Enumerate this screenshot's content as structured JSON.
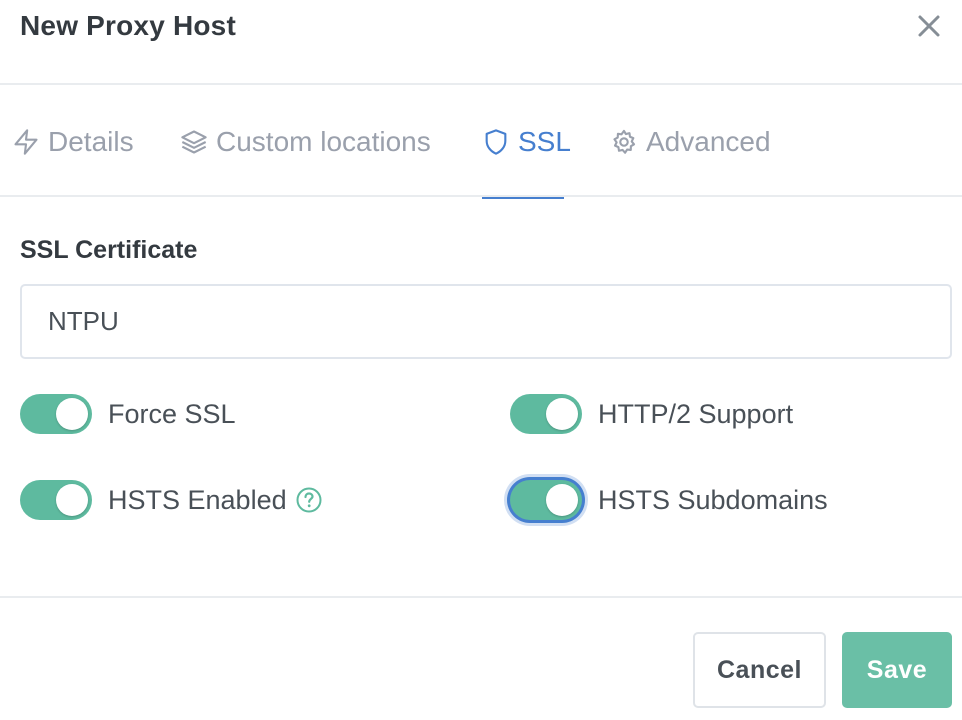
{
  "header": {
    "title": "New Proxy Host"
  },
  "tabs": [
    {
      "label": "Details",
      "icon": "lightning-icon",
      "active": false
    },
    {
      "label": "Custom locations",
      "icon": "layers-icon",
      "active": false
    },
    {
      "label": "SSL",
      "icon": "shield-icon",
      "active": true
    },
    {
      "label": "Advanced",
      "icon": "gear-icon",
      "active": false
    }
  ],
  "ssl": {
    "section_label": "SSL Certificate",
    "certificate_value": "NTPU",
    "toggles": {
      "force_ssl": {
        "label": "Force SSL",
        "on": true
      },
      "http2": {
        "label": "HTTP/2 Support",
        "on": true
      },
      "hsts": {
        "label": "HSTS Enabled",
        "on": true
      },
      "hsts_subdomains": {
        "label": "HSTS Subdomains",
        "on": true
      }
    }
  },
  "footer": {
    "cancel_label": "Cancel",
    "save_label": "Save"
  },
  "colors": {
    "accent": "#467fcf",
    "toggle_on": "#5eba9f",
    "save_button": "#5eba9f",
    "muted_text": "#9aa0ac"
  }
}
